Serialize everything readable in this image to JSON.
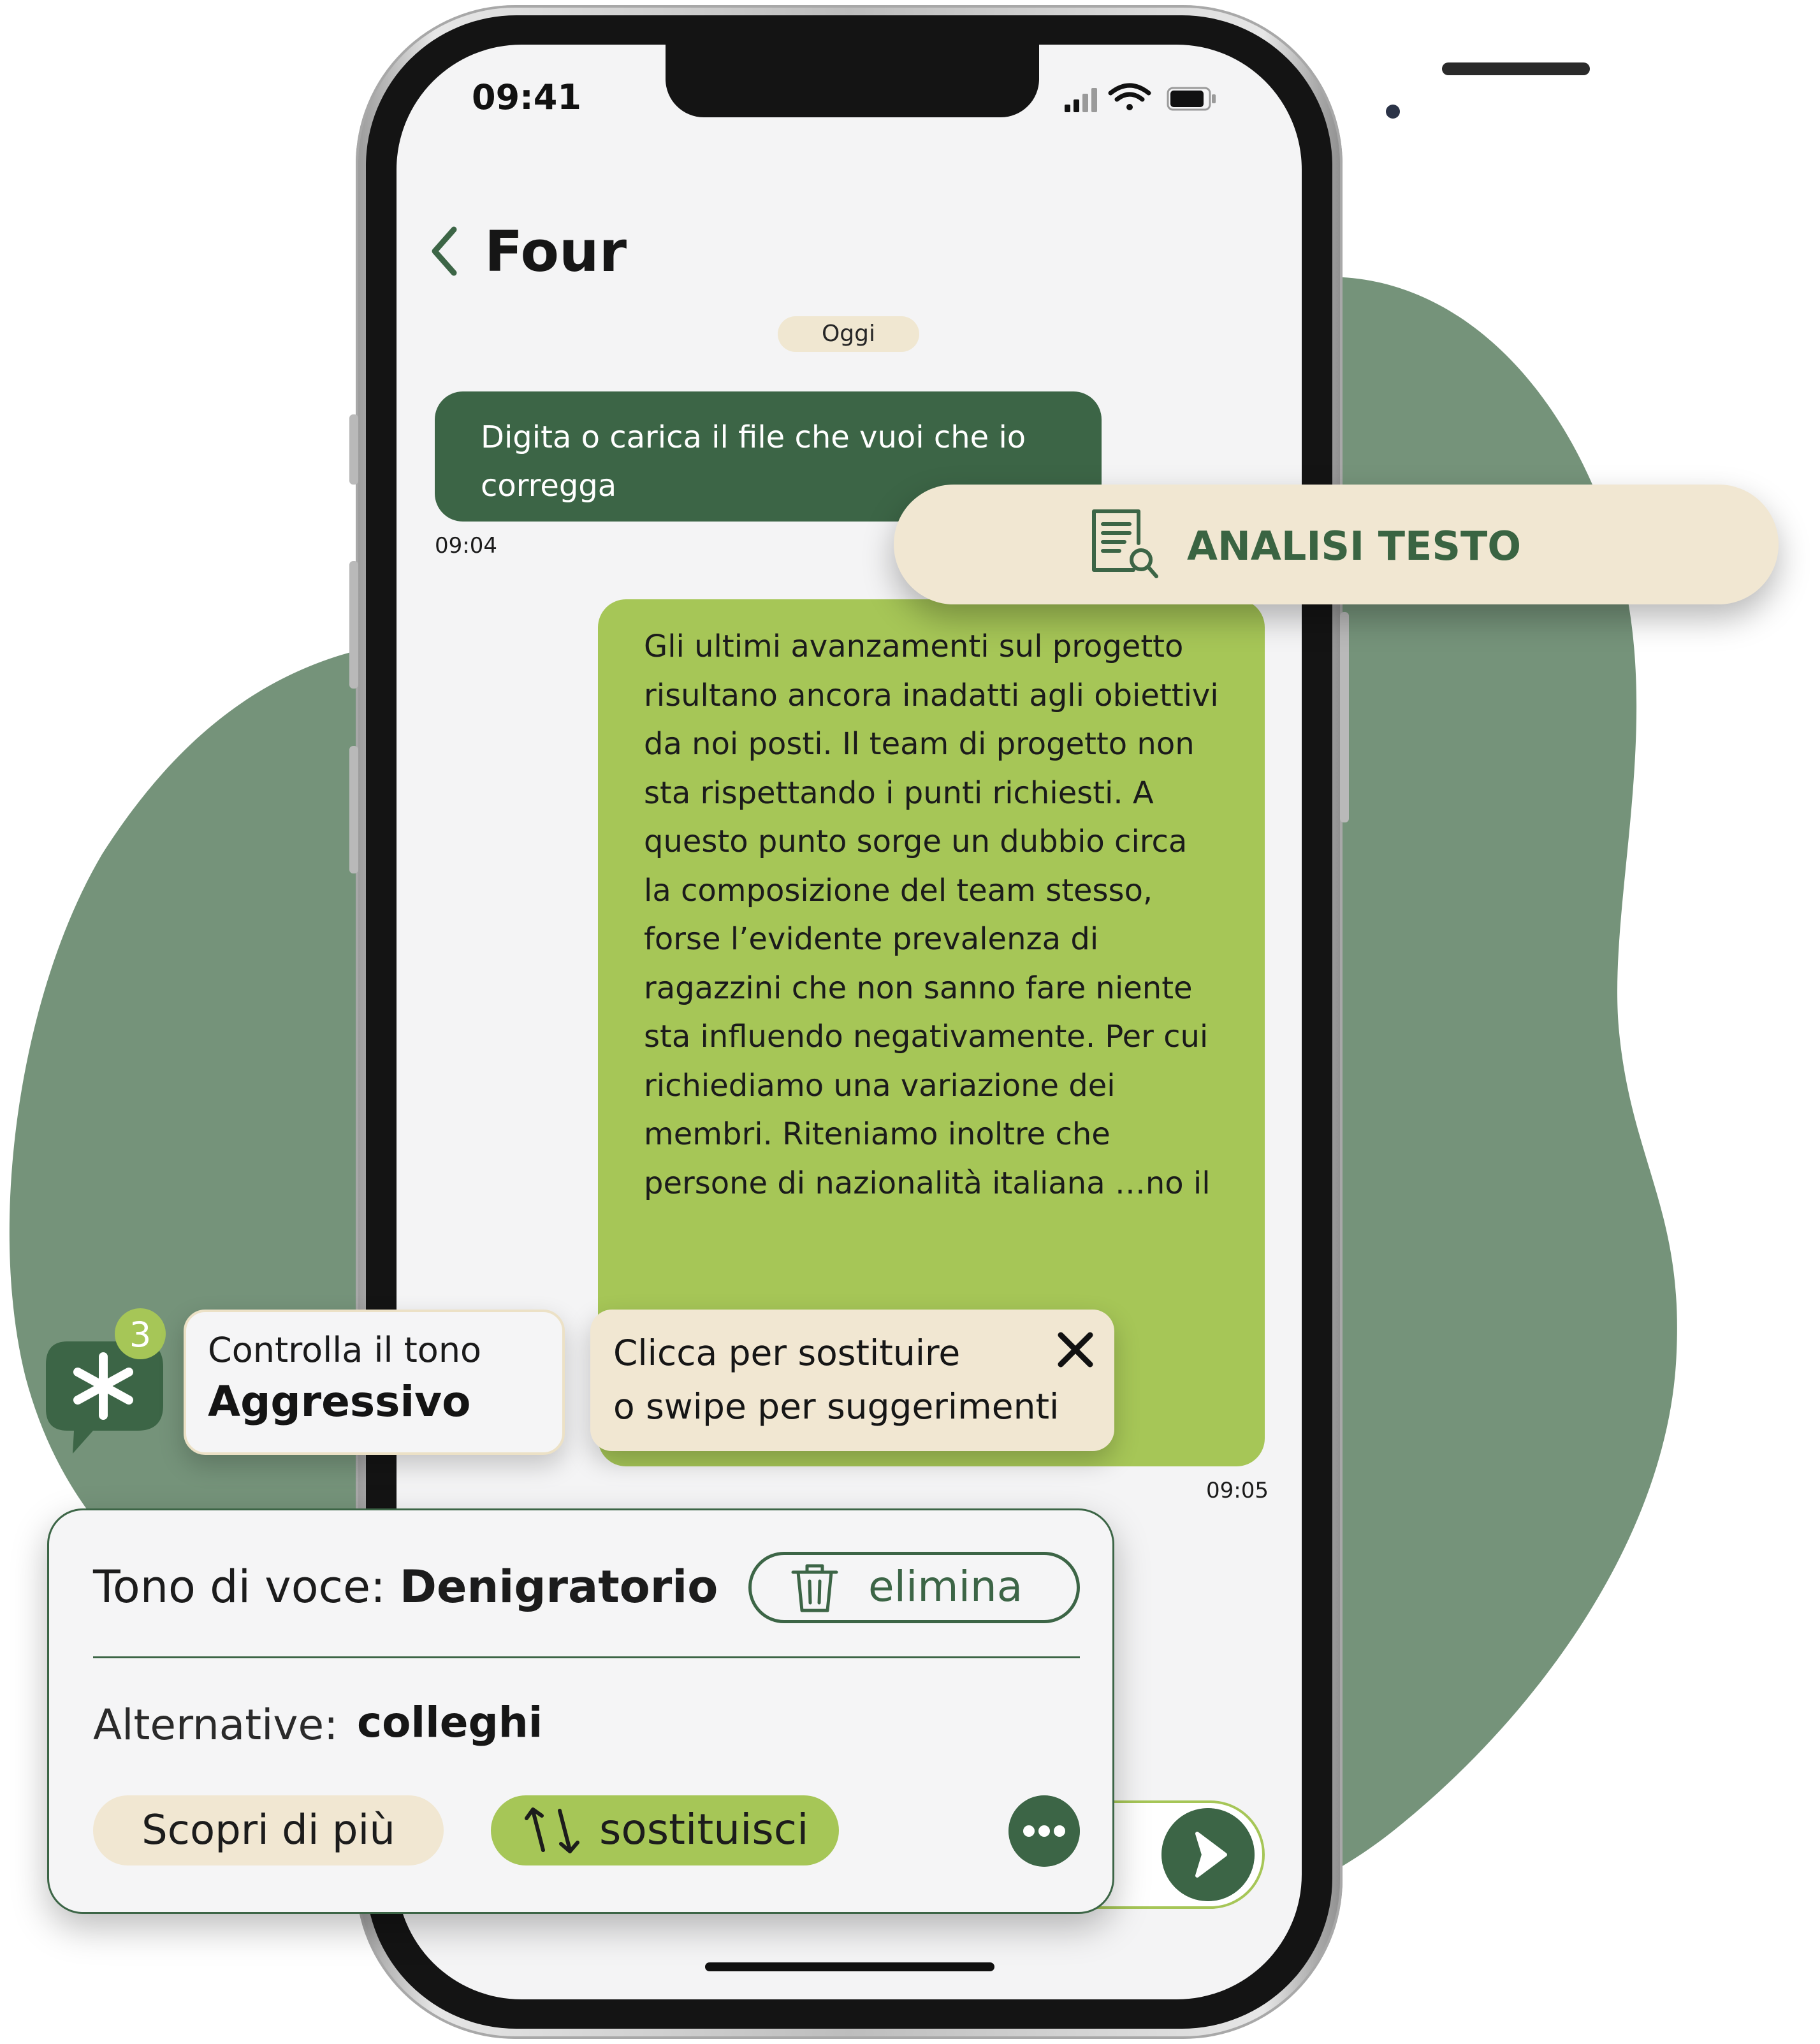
{
  "colors": {
    "background": "#ffffff",
    "blob": "#75937a",
    "screen": "#f4f4f5",
    "dark_green": "#3c6546",
    "lime_green": "#a6c657",
    "cream": "#f1e7d2"
  },
  "status_bar": {
    "time": "09:41",
    "icons": [
      "signal-icon",
      "wifi-icon",
      "battery-icon"
    ]
  },
  "header": {
    "back_icon": "chevron-left-icon",
    "title": "Four"
  },
  "chat": {
    "date_label": "Oggi",
    "incoming": {
      "text": "Digita o carica il file che vuoi che io correggа",
      "time": "09:04"
    },
    "outgoing": {
      "text": "Gli ultimi avanzamenti sul progetto risultano ancora inadatti agli obiettivi da noi posti. Il team di progetto non sta rispettando i punti richiesti. A questo punto sorge un dubbio circa la composizione del team stesso, forse l’evidente prevalenza di ragazzini che non sanno fare niente sta influendo negativamente. Per cui richiediamo una variazione dei membri. Riteniamo inoltre che persone di nazionalità italiana …no il",
      "time": "09:05"
    }
  },
  "analysis_button": {
    "icon": "document-search-icon",
    "label": "ANALISI TESTO"
  },
  "tone_check": {
    "icon": "asterisk-chat-icon",
    "badge_count": "3",
    "line1": "Controlla il tono",
    "line2": "Aggressivo"
  },
  "hint": {
    "line1": "Clicca per sostituire",
    "line2": "o swipe per suggerimenti",
    "close_icon": "close-icon"
  },
  "suggestion_panel": {
    "title_prefix": "Tono di voce: ",
    "title_value": "Denigratorio",
    "delete_label": "elimina",
    "delete_icon": "trash-icon",
    "alternatives_label": "Alternative:",
    "alternative_value": "colleghi",
    "learn_more_label": "Scopri di più",
    "replace_label": "sostituisci",
    "replace_icon": "swap-arrows-icon",
    "more_icon": "more-dots-icon"
  },
  "composer": {
    "send_icon": "send-arrow-icon"
  }
}
